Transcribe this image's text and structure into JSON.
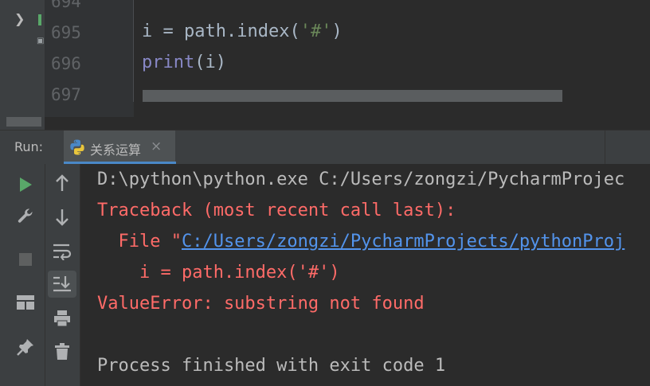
{
  "editor": {
    "line_numbers": [
      "694",
      "695",
      "696",
      "697"
    ],
    "code_line_695": {
      "var": "i",
      "op": " = ",
      "obj": "path.index(",
      "str": "'#'",
      "close": ")"
    },
    "code_line_696": {
      "func": "print",
      "args": "(i)"
    }
  },
  "run_panel": {
    "label": "Run:",
    "tab": {
      "title": "关系运算",
      "icon": "python-icon",
      "close_glyph": "×"
    }
  },
  "toolbar_left": [
    "run-icon",
    "wrench-icon",
    "stop-icon",
    "layout-icon",
    "pin-icon"
  ],
  "toolbar_right": [
    "arrow-up-icon",
    "arrow-down-icon",
    "soft-wrap-icon",
    "scroll-to-end-icon",
    "print-icon",
    "trash-icon"
  ],
  "console": {
    "line1": "D:\\python\\python.exe C:/Users/zongzi/PycharmProjec",
    "line2": "Traceback (most recent call last):",
    "line3_prefix": "  File \"",
    "line3_link": "C:/Users/zongzi/PycharmProjects/pythonProj",
    "line4": "    i = path.index('#')",
    "line5": "ValueError: substring not found",
    "line7": "Process finished with exit code 1"
  },
  "colors": {
    "background": "#2b2b2b",
    "error": "#ff6b68",
    "link": "#5394ec",
    "accent": "#4a88c7",
    "run_green": "#59a869"
  }
}
